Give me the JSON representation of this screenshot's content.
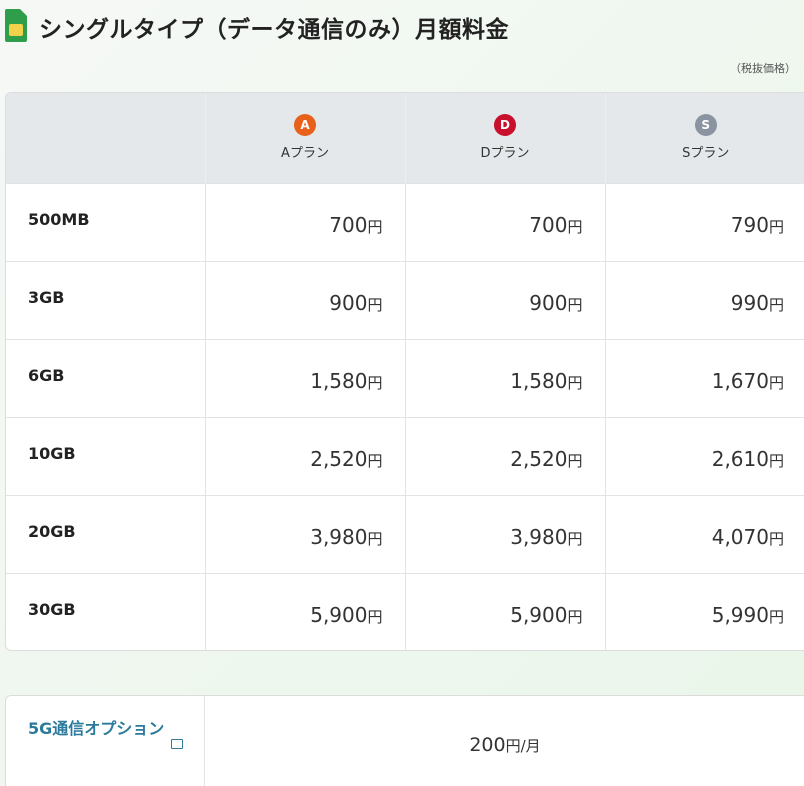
{
  "header": {
    "title": "シングルタイプ（データ通信のみ）月額料金",
    "icon": "sim-card-icon",
    "icon_color": "#2e9e4a"
  },
  "tax_note": "（税抜価格）",
  "plans": [
    {
      "badge": "A",
      "name": "Aプラン",
      "color": "#e8611a"
    },
    {
      "badge": "D",
      "name": "Dプラン",
      "color": "#c8102e"
    },
    {
      "badge": "S",
      "name": "Sプラン",
      "color": "#8a94a0"
    }
  ],
  "yen_unit": "円",
  "rows": [
    {
      "label": "500MB",
      "prices": [
        "700",
        "700",
        "790"
      ]
    },
    {
      "label": "3GB",
      "prices": [
        "900",
        "900",
        "990"
      ]
    },
    {
      "label": "6GB",
      "prices": [
        "1,580",
        "1,580",
        "1,670"
      ]
    },
    {
      "label": "10GB",
      "prices": [
        "2,520",
        "2,520",
        "2,610"
      ]
    },
    {
      "label": "20GB",
      "prices": [
        "3,980",
        "3,980",
        "4,070"
      ]
    },
    {
      "label": "30GB",
      "prices": [
        "5,900",
        "5,900",
        "5,990"
      ]
    }
  ],
  "option": {
    "label": "5G通信オプション",
    "link_icon": "external-window-icon",
    "value": "200",
    "unit": "円/月",
    "label_color": "#2b7a9b"
  }
}
